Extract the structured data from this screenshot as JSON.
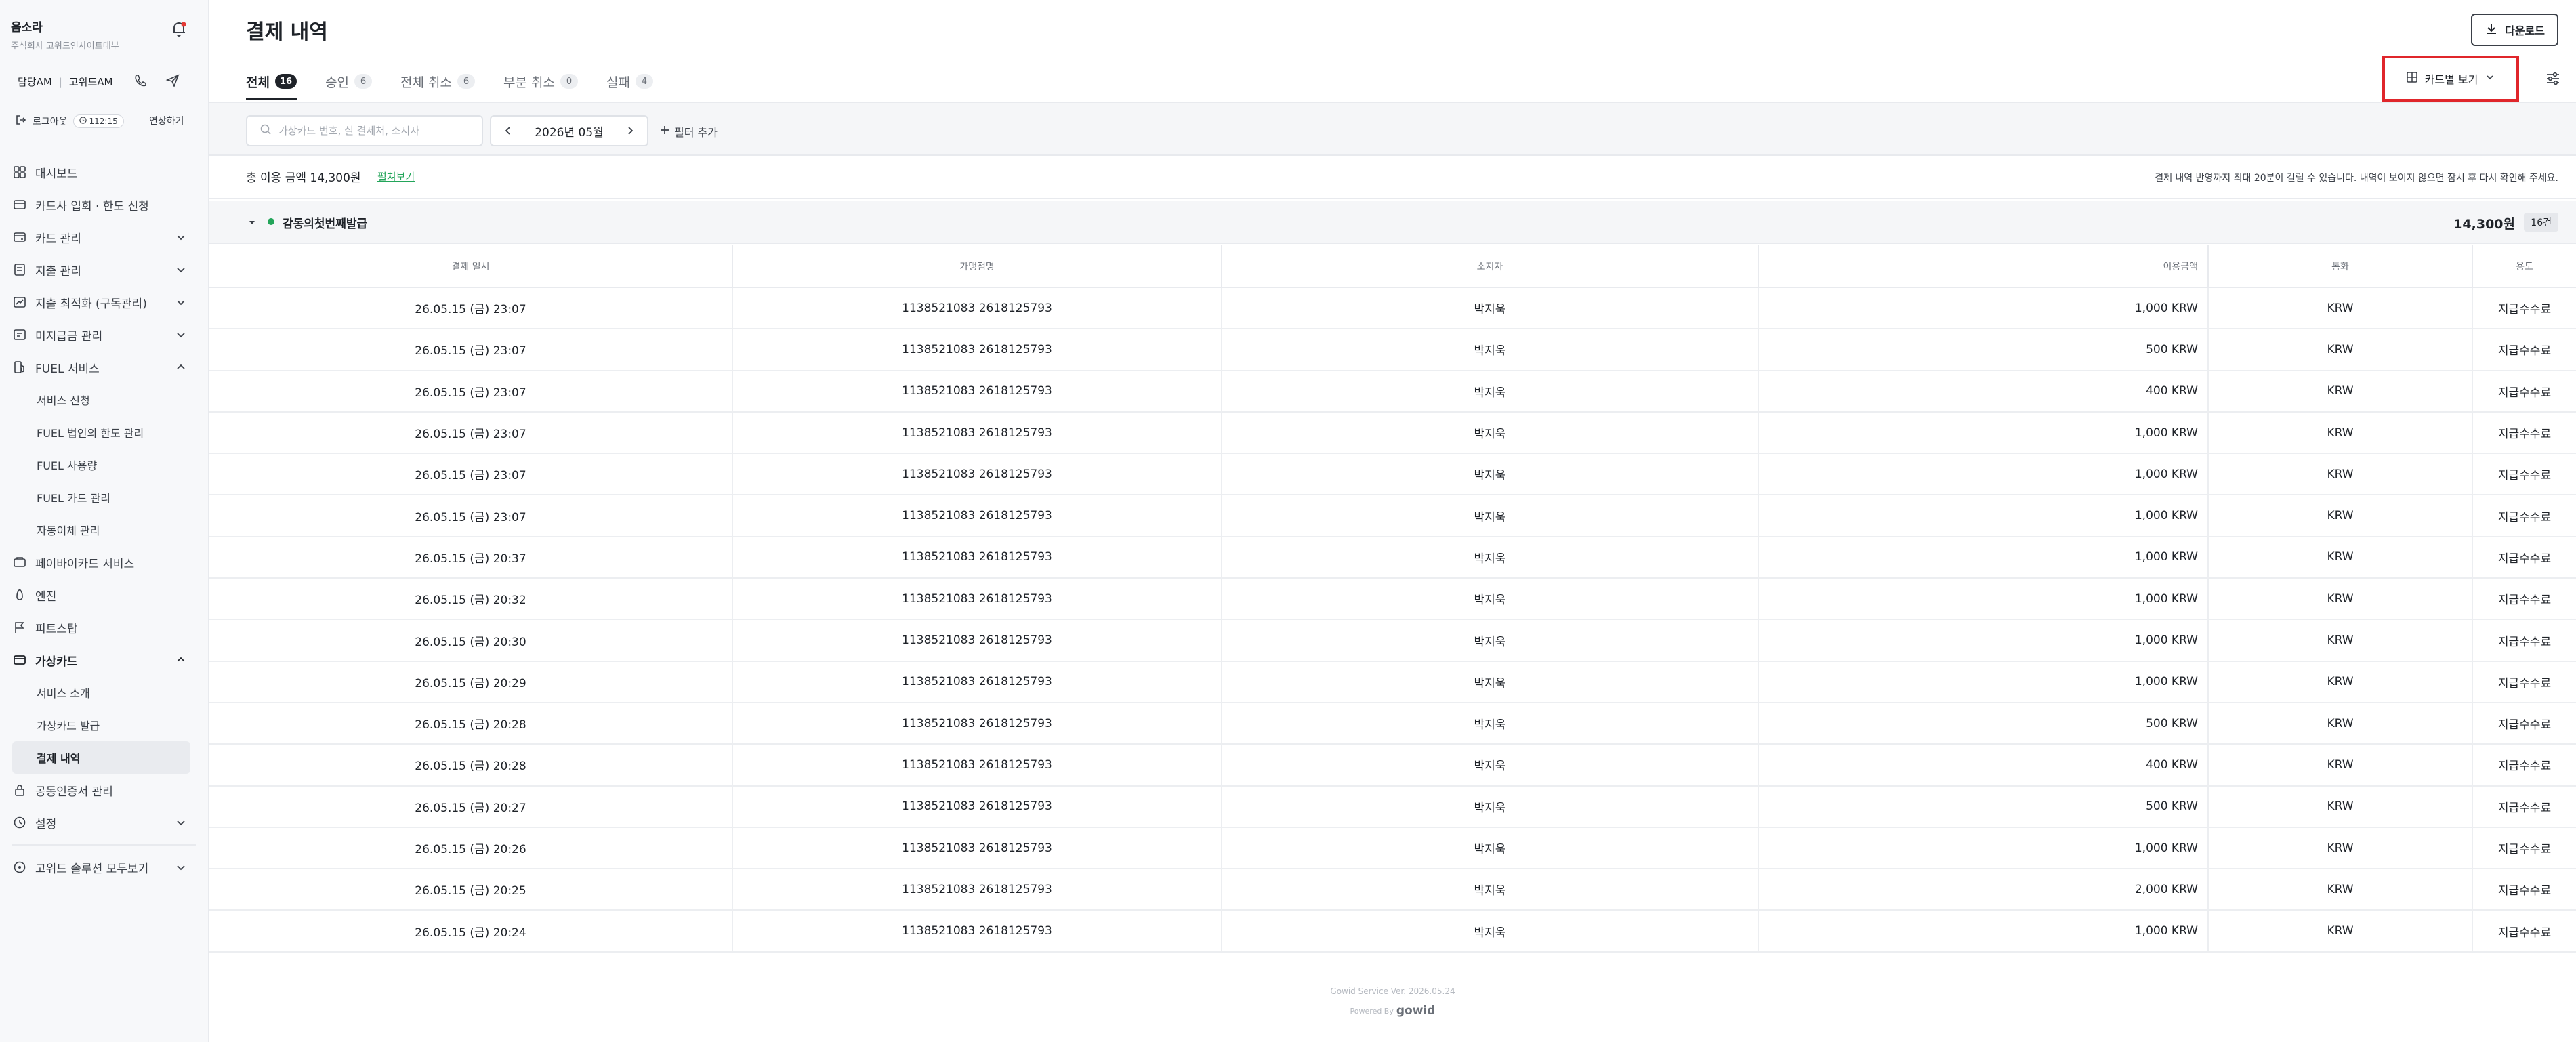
{
  "sidebar": {
    "user_name": "음소라",
    "company": "주식회사 고위드인사이트대부",
    "am_label": "담당AM",
    "am_name": "고위드AM",
    "logout_label": "로그아웃",
    "timer": "112:15",
    "extend_label": "연장하기",
    "nav": [
      {
        "label": "대시보드",
        "icon": "dashboard-icon"
      },
      {
        "label": "카드사 입회 · 한도 신청",
        "icon": "card-apply-icon"
      },
      {
        "label": "카드 관리",
        "icon": "card-manage-icon"
      },
      {
        "label": "지출 관리",
        "icon": "expense-icon"
      },
      {
        "label": "지출 최적화 (구독관리)",
        "icon": "optimize-icon"
      },
      {
        "label": "미지급금 관리",
        "icon": "unpaid-icon"
      },
      {
        "label": "FUEL 서비스",
        "icon": "fuel-icon"
      },
      {
        "label": "서비스 신청"
      },
      {
        "label": "FUEL 법인의 한도 관리"
      },
      {
        "label": "FUEL 사용량"
      },
      {
        "label": "FUEL 카드 관리"
      },
      {
        "label": "자동이체 관리"
      },
      {
        "label": "페이바이카드 서비스",
        "icon": "paybycard-icon"
      },
      {
        "label": "엔진",
        "icon": "engine-icon"
      },
      {
        "label": "피트스탑",
        "icon": "pitstop-icon"
      },
      {
        "label": "가상카드",
        "icon": "virtual-card-icon"
      },
      {
        "label": "서비스 소개"
      },
      {
        "label": "가상카드 발급"
      },
      {
        "label": "결제 내역"
      },
      {
        "label": "공동인증서 관리",
        "icon": "certificate-icon"
      },
      {
        "label": "설정",
        "icon": "settings-icon"
      },
      {
        "label": "고위드 솔루션 모두보기",
        "icon": "solutions-icon"
      }
    ]
  },
  "header": {
    "title": "결제 내역",
    "download_label": "다운로드",
    "view_label": "카드별 보기"
  },
  "tabs": [
    {
      "label": "전체",
      "count": "16"
    },
    {
      "label": "승인",
      "count": "6"
    },
    {
      "label": "전체 취소",
      "count": "6"
    },
    {
      "label": "부분 취소",
      "count": "0"
    },
    {
      "label": "실패",
      "count": "4"
    }
  ],
  "filters": {
    "search_placeholder": "가상카드 번호, 실 결제처, 소지자",
    "month": "2026년 05월",
    "add_filter_label": "필터 추가"
  },
  "summary": {
    "total_label": "총 이용 금액",
    "total_value": "14,300원",
    "fold_label": "펼쳐보기",
    "notice": "결제 내역 반영까지 최대 20분이 걸릴 수 있습니다. 내역이 보이지 않으면 잠시 후 다시 확인해 주세요."
  },
  "group": {
    "name": "감동의첫번째발급",
    "amount": "14,300원",
    "count": "16건"
  },
  "table": {
    "columns": [
      "결제 일시",
      "가맹점명",
      "소지자",
      "이용금액",
      "통화",
      "용도"
    ],
    "rows": [
      [
        "26.05.15 (금) 23:07",
        "1138521083 2618125793",
        "박지욱",
        "1,000 KRW",
        "KRW",
        "지급수수료"
      ],
      [
        "26.05.15 (금) 23:07",
        "1138521083 2618125793",
        "박지욱",
        "500 KRW",
        "KRW",
        "지급수수료"
      ],
      [
        "26.05.15 (금) 23:07",
        "1138521083 2618125793",
        "박지욱",
        "400 KRW",
        "KRW",
        "지급수수료"
      ],
      [
        "26.05.15 (금) 23:07",
        "1138521083 2618125793",
        "박지욱",
        "1,000 KRW",
        "KRW",
        "지급수수료"
      ],
      [
        "26.05.15 (금) 23:07",
        "1138521083 2618125793",
        "박지욱",
        "1,000 KRW",
        "KRW",
        "지급수수료"
      ],
      [
        "26.05.15 (금) 23:07",
        "1138521083 2618125793",
        "박지욱",
        "1,000 KRW",
        "KRW",
        "지급수수료"
      ],
      [
        "26.05.15 (금) 20:37",
        "1138521083 2618125793",
        "박지욱",
        "1,000 KRW",
        "KRW",
        "지급수수료"
      ],
      [
        "26.05.15 (금) 20:32",
        "1138521083 2618125793",
        "박지욱",
        "1,000 KRW",
        "KRW",
        "지급수수료"
      ],
      [
        "26.05.15 (금) 20:30",
        "1138521083 2618125793",
        "박지욱",
        "1,000 KRW",
        "KRW",
        "지급수수료"
      ],
      [
        "26.05.15 (금) 20:29",
        "1138521083 2618125793",
        "박지욱",
        "1,000 KRW",
        "KRW",
        "지급수수료"
      ],
      [
        "26.05.15 (금) 20:28",
        "1138521083 2618125793",
        "박지욱",
        "500 KRW",
        "KRW",
        "지급수수료"
      ],
      [
        "26.05.15 (금) 20:28",
        "1138521083 2618125793",
        "박지욱",
        "400 KRW",
        "KRW",
        "지급수수료"
      ],
      [
        "26.05.15 (금) 20:27",
        "1138521083 2618125793",
        "박지욱",
        "500 KRW",
        "KRW",
        "지급수수료"
      ],
      [
        "26.05.15 (금) 20:26",
        "1138521083 2618125793",
        "박지욱",
        "1,000 KRW",
        "KRW",
        "지급수수료"
      ],
      [
        "26.05.15 (금) 20:25",
        "1138521083 2618125793",
        "박지욱",
        "2,000 KRW",
        "KRW",
        "지급수수료"
      ],
      [
        "26.05.15 (금) 20:24",
        "1138521083 2618125793",
        "박지욱",
        "1,000 KRW",
        "KRW",
        "지급수수료"
      ]
    ]
  },
  "footer": {
    "version": "Gowid Service Ver. 2026.05.24",
    "powered": "Powered By",
    "logo": "gowid"
  },
  "colors": {
    "accent_green": "#23a55a",
    "highlight_red": "#e0262b",
    "notification_red": "#e53935"
  }
}
